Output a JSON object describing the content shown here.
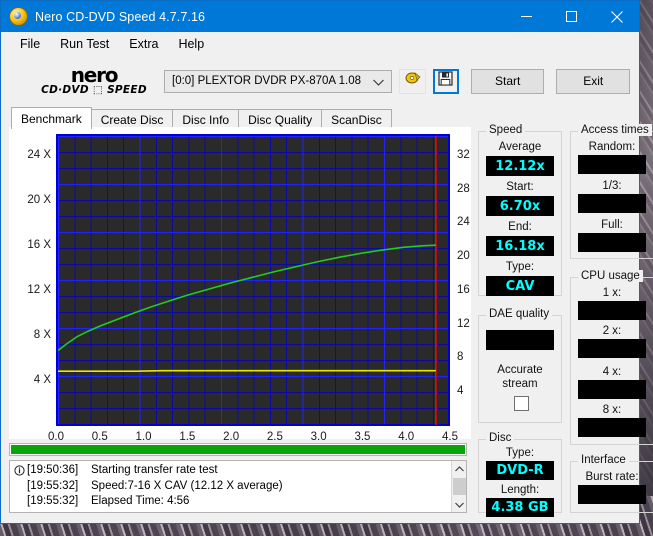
{
  "window": {
    "title": "Nero CD-DVD Speed 4.7.7.16",
    "icon": "nero-disc-icon",
    "minimize": "minimize-icon",
    "maximize": "maximize-icon",
    "close": "close-icon"
  },
  "menu": [
    "File",
    "Run Test",
    "Extra",
    "Help"
  ],
  "toolbar": {
    "logo_line1": "nero",
    "logo_line2": "CD·DVD",
    "logo_line3": "SPEED",
    "drive": "[0:0]   PLEXTOR DVDR   PX-870A 1.08",
    "dropdown_icon": "chevron-down-icon",
    "disc_tool_icon": "disc-eject-icon",
    "save_icon": "floppy-save-icon",
    "start_label": "Start",
    "exit_label": "Exit"
  },
  "tabs": [
    {
      "label": "Benchmark",
      "active": true
    },
    {
      "label": "Create Disc",
      "active": false
    },
    {
      "label": "Disc Info",
      "active": false
    },
    {
      "label": "Disc Quality",
      "active": false
    },
    {
      "label": "ScanDisc",
      "active": false
    }
  ],
  "chart_data": {
    "type": "line",
    "title": "",
    "xlabel": "",
    "ylabel": "",
    "xlim": [
      0.0,
      4.5
    ],
    "ylim": [
      0,
      26
    ],
    "y2lim": [
      0,
      34.6
    ],
    "grid": true,
    "legend": "none",
    "xticks": [
      "0.0",
      "0.5",
      "1.0",
      "1.5",
      "2.0",
      "2.5",
      "3.0",
      "3.5",
      "4.0",
      "4.5"
    ],
    "xtick_values": [
      0.0,
      0.5,
      1.0,
      1.5,
      2.0,
      2.5,
      3.0,
      3.5,
      4.0,
      4.5
    ],
    "yticks_left": [
      "24 X",
      "20 X",
      "16 X",
      "12 X",
      "8 X",
      "4 X"
    ],
    "ytick_left_values": [
      24,
      20,
      16,
      12,
      8,
      4
    ],
    "yticks_right": [
      "32",
      "28",
      "24",
      "20",
      "16",
      "12",
      "8",
      "4"
    ],
    "ytick_right_values": [
      32,
      28,
      24,
      20,
      16,
      12,
      8,
      4
    ],
    "marker_line_x": 4.36,
    "series": [
      {
        "name": "transfer-rate",
        "color": "#22cc22",
        "axis": "left",
        "x": [
          0.0,
          0.1,
          0.22,
          0.35,
          0.5,
          0.7,
          0.9,
          1.1,
          1.3,
          1.5,
          1.75,
          2.0,
          2.25,
          2.5,
          2.75,
          3.0,
          3.25,
          3.5,
          3.75,
          4.0,
          4.2,
          4.36
        ],
        "values": [
          6.7,
          7.3,
          7.95,
          8.45,
          8.95,
          9.55,
          10.15,
          10.7,
          11.2,
          11.7,
          12.25,
          12.8,
          13.3,
          13.8,
          14.25,
          14.7,
          15.1,
          15.45,
          15.75,
          16.0,
          16.12,
          16.18
        ]
      },
      {
        "name": "cpu-usage-line",
        "color": "#e8e800",
        "axis": "right",
        "x": [
          0.0,
          0.3,
          0.6,
          0.9,
          1.2,
          1.6,
          2.0,
          2.5,
          3.0,
          3.5,
          4.0,
          4.36
        ],
        "values": [
          6.45,
          6.45,
          6.45,
          6.45,
          6.5,
          6.5,
          6.5,
          6.5,
          6.5,
          6.5,
          6.5,
          6.5
        ]
      }
    ]
  },
  "progress": {
    "percent": 100
  },
  "log": {
    "info_icon": "info-icon",
    "scroll_up_icon": "chevron-up-icon",
    "scroll_down_icon": "chevron-down-icon",
    "lines": [
      {
        "icon": true,
        "time": "[19:50:36]",
        "text": "Starting transfer rate test"
      },
      {
        "icon": false,
        "time": "[19:55:32]",
        "text": "Speed:7-16 X CAV (12.12 X average)"
      },
      {
        "icon": false,
        "time": "[19:55:32]",
        "text": "Elapsed Time:  4:56"
      }
    ]
  },
  "panels": {
    "speed": {
      "title": "Speed",
      "fields": [
        {
          "label": "Average",
          "value": "12.12x"
        },
        {
          "label": "Start:",
          "value": "6.70x"
        },
        {
          "label": "End:",
          "value": "16.18x"
        },
        {
          "label": "Type:",
          "value": "CAV"
        }
      ]
    },
    "dae_quality": {
      "title": "DAE quality",
      "value": "",
      "checkbox_label_line1": "Accurate",
      "checkbox_label_line2": "stream",
      "checkbox_checked": false
    },
    "disc": {
      "title": "Disc",
      "fields": [
        {
          "label": "Type:",
          "value": "DVD-R"
        },
        {
          "label": "Length:",
          "value": "4.38 GB"
        }
      ]
    },
    "access_times": {
      "title": "Access times",
      "fields": [
        {
          "label": "Random:",
          "value": ""
        },
        {
          "label": "1/3:",
          "value": ""
        },
        {
          "label": "Full:",
          "value": ""
        }
      ]
    },
    "cpu_usage": {
      "title": "CPU usage",
      "fields": [
        {
          "label": "1 x:",
          "value": ""
        },
        {
          "label": "2 x:",
          "value": ""
        },
        {
          "label": "4 x:",
          "value": ""
        },
        {
          "label": "8 x:",
          "value": ""
        }
      ]
    },
    "interface": {
      "title": "Interface",
      "fields": [
        {
          "label": "Burst rate:",
          "value": ""
        }
      ]
    }
  },
  "colors": {
    "accent": "#0078d7",
    "value_text": "#00ffff",
    "graph_line": "#22cc22",
    "graph_secondary": "#e8e800",
    "progress": "#09a409",
    "grid": "#0000c8",
    "marker": "#ff0000"
  }
}
